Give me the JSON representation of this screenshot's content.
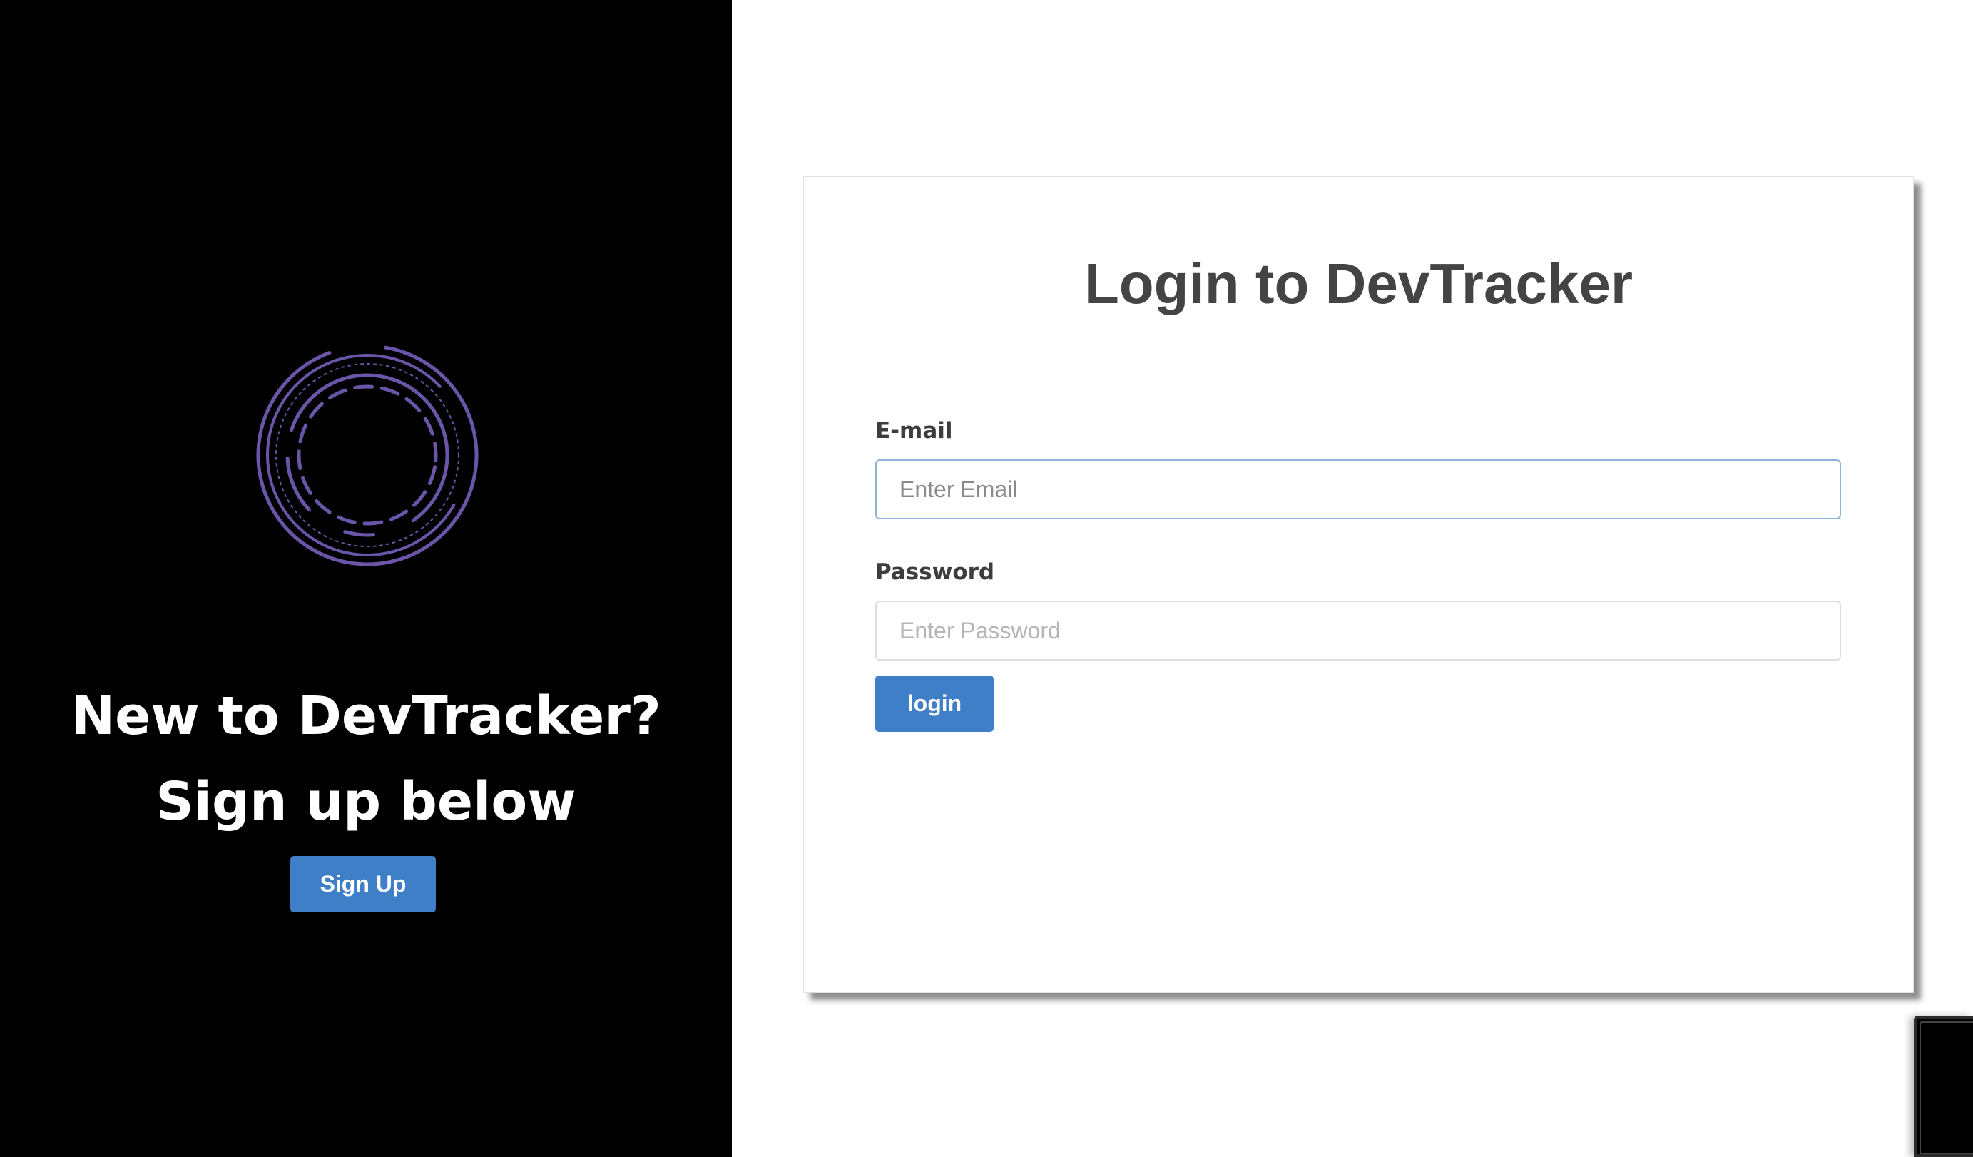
{
  "left_panel": {
    "heading": "New to DevTracker? Sign up below",
    "signup_button_label": "Sign Up",
    "logo_color": "#6a55a8"
  },
  "login_card": {
    "title": "Login to DevTracker",
    "email": {
      "label": "E-mail",
      "placeholder": "Enter Email",
      "value": ""
    },
    "password": {
      "label": "Password",
      "placeholder": "Enter Password",
      "value": ""
    },
    "login_button_label": "login",
    "accent_color": "#3f7fc7"
  }
}
